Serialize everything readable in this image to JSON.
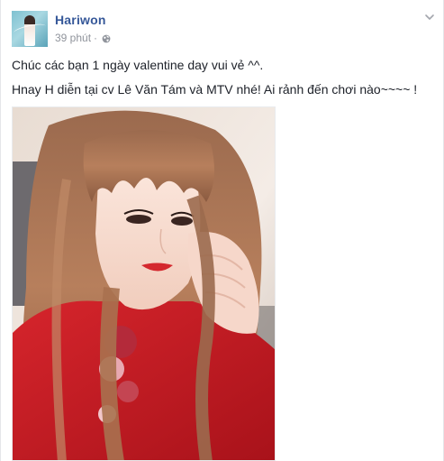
{
  "post": {
    "author": "Hariwon",
    "time": "39 phút",
    "separator": "·",
    "line1": "Chúc các bạn 1 ngày valentine day vui vẻ ^^.",
    "line2": "Hnay H diễn tại cv Lê Văn Tám và MTV nhé! Ai rảnh đến chơi nào~~~~ !"
  },
  "icons": {
    "privacy": "globe-icon",
    "menu": "chevron-down-icon"
  },
  "colors": {
    "author_link": "#365899",
    "meta_text": "#90949c",
    "body_text": "#1d2129"
  }
}
